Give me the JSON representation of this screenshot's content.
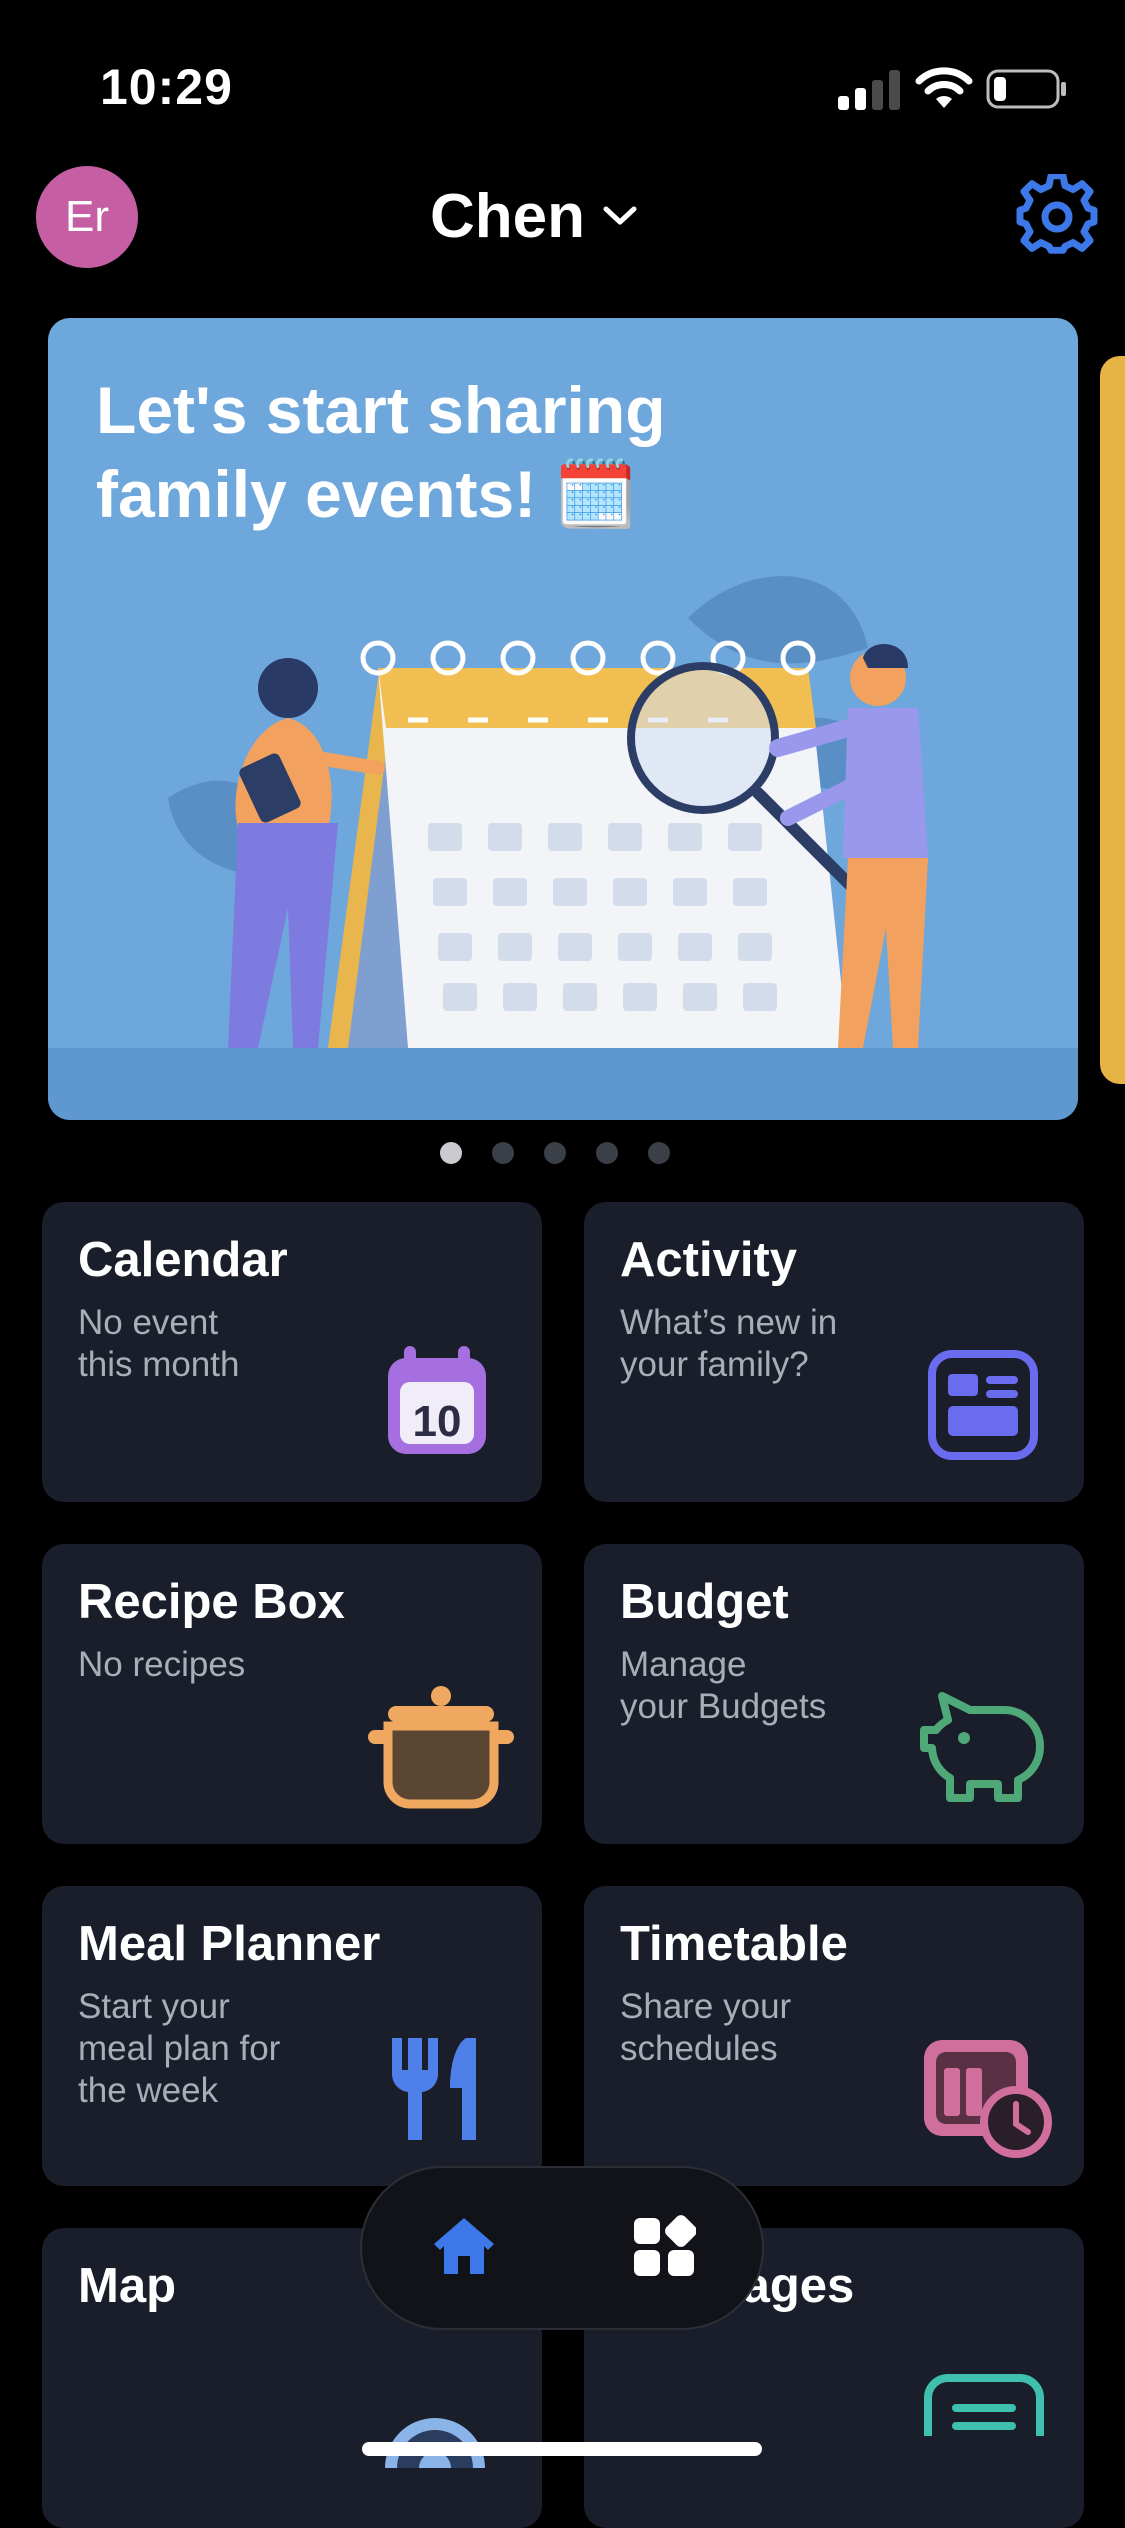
{
  "status_bar": {
    "time": "10:29"
  },
  "header": {
    "avatar_initials": "Er",
    "family_name": "Chen"
  },
  "banner": {
    "title_line1": "Let's start sharing",
    "title_line2": "family events! 🗓️",
    "page_count": 5,
    "active_index": 0
  },
  "cards": [
    {
      "title": "Calendar",
      "subtitle": "No event\nthis month",
      "icon": "calendar-icon",
      "icon_text": "10",
      "color": "#a56fe0"
    },
    {
      "title": "Activity",
      "subtitle": "What’s new in\nyour family?",
      "icon": "newsfeed-icon",
      "color": "#6a6cf0"
    },
    {
      "title": "Recipe Box",
      "subtitle": "No recipes",
      "icon": "cooking-pot-icon",
      "color": "#f0a860"
    },
    {
      "title": "Budget",
      "subtitle": "Manage\nyour Budgets",
      "icon": "piggy-bank-icon",
      "color": "#4fa877"
    },
    {
      "title": "Meal Planner",
      "subtitle": "Start your\nmeal plan for\nthe week",
      "icon": "fork-knife-icon",
      "color": "#4f7fe8"
    },
    {
      "title": "Timetable",
      "subtitle": "Share your\nschedules",
      "icon": "timetable-clock-icon",
      "color": "#d06e9c"
    },
    {
      "title": "Map",
      "subtitle": "",
      "icon": "map-pin-icon",
      "color": "#8ab4e8"
    },
    {
      "title": "Messages",
      "subtitle": "",
      "icon": "message-icon",
      "color": "#3fbfae"
    }
  ],
  "bottom_nav": {
    "items": [
      "home-icon",
      "apps-grid-icon"
    ],
    "active": "home-icon"
  },
  "colors": {
    "background": "#000000",
    "card": "#1a1e2a",
    "accent": "#3d78e8",
    "banner": "#6ea7dc"
  }
}
